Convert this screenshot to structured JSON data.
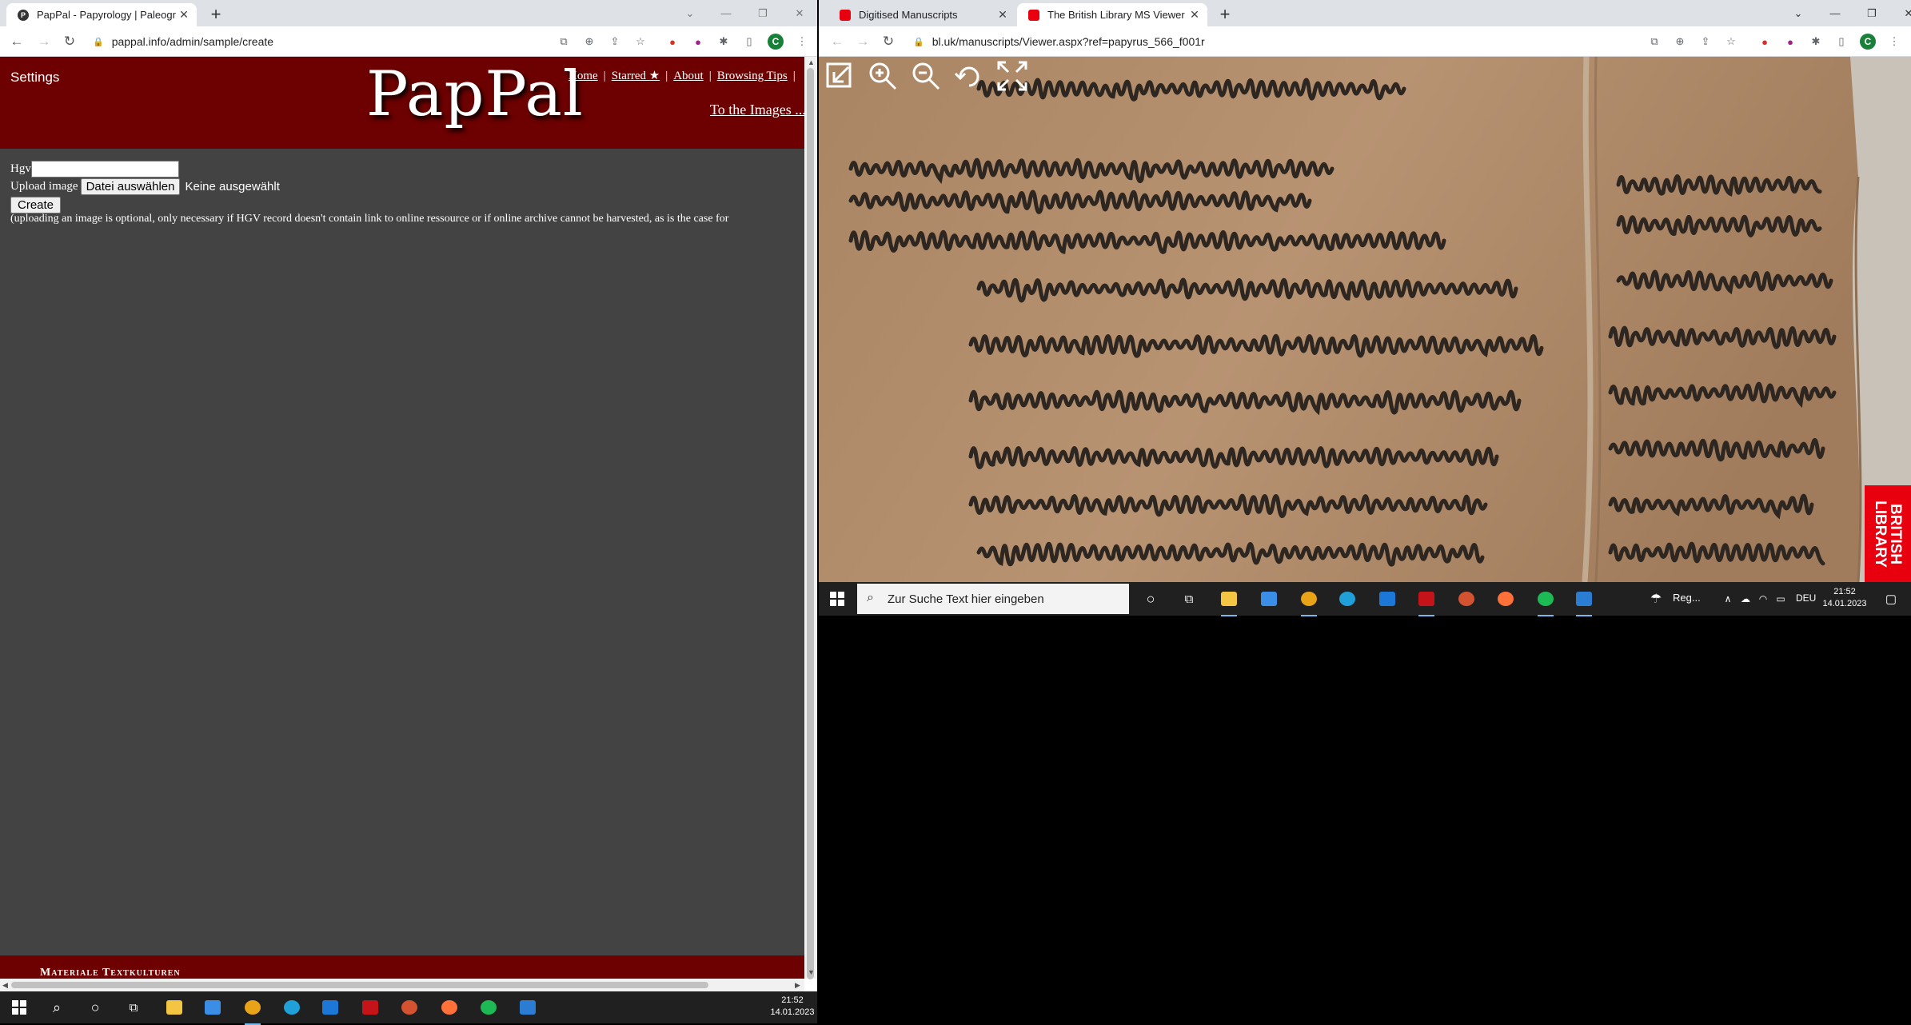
{
  "left_browser": {
    "tabs": [
      {
        "title": "PapPal - Papyrology | Paleograph",
        "active": true
      }
    ],
    "url": "pappal.info/admin/sample/create",
    "profile_initial": "C"
  },
  "pappal": {
    "settings": "Settings",
    "logo": "PapPal",
    "nav": [
      "Home",
      "Starred ★",
      "About",
      "Browsing Tips"
    ],
    "to_images": "To the Images ...",
    "form": {
      "hgv_label": "Hgv",
      "hgv_value": "",
      "upload_label": "Upload image",
      "choose_file": "Datei auswählen",
      "no_file": "Keine ausgewählt",
      "create": "Create",
      "note": "(uploading an image is optional, only necessary if HGV record doesn't contain link to online ressource or if online archive cannot be harvested, as is the case for"
    },
    "footer": "Materiale Textkulturen"
  },
  "right_browser": {
    "tabs": [
      {
        "title": "Digitised Manuscripts",
        "active": false
      },
      {
        "title": "The British Library MS Viewer",
        "active": true
      }
    ],
    "url": "bl.uk/manuscripts/Viewer.aspx?ref=papyrus_566_f001r",
    "profile_initial": "C"
  },
  "bl_viewer": {
    "tools": [
      "exit-icon",
      "zoom-in-icon",
      "zoom-out-icon",
      "rotate-icon",
      "fullscreen-icon"
    ],
    "badge": "BRITISH\nLIBRARY"
  },
  "taskbar_left": {
    "time": "21:52",
    "date": "14.01.2023"
  },
  "taskbar_right": {
    "search_placeholder": "Zur Suche Text hier eingeben",
    "weather": "Reg...",
    "lang": "DEU",
    "time": "21:52",
    "date": "14.01.2023"
  },
  "colors": {
    "pappal_red": "#6d0000",
    "pappal_bg": "#434343",
    "bl_red": "#e8000f",
    "papyrus": "#b08a68"
  }
}
